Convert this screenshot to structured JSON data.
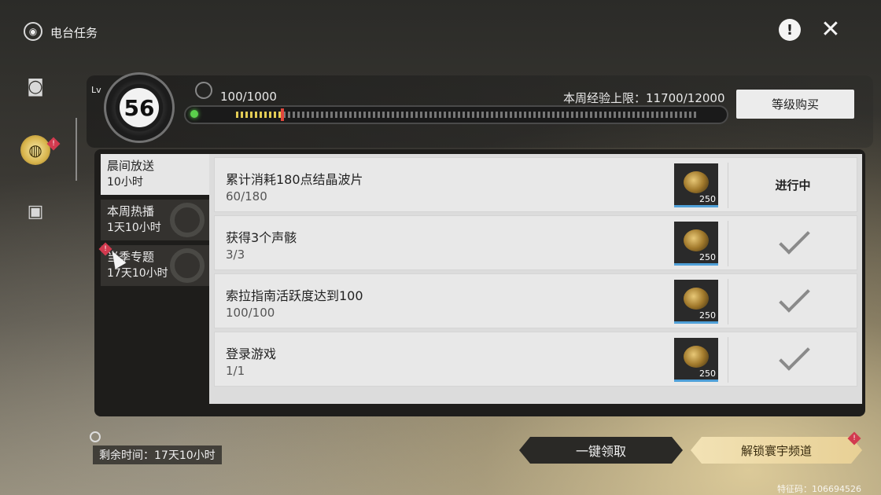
{
  "header": {
    "title": "电台任务",
    "app_icon": "radio-icon",
    "help_icon": "exclamation-circle-icon",
    "close_icon": "close-star-icon"
  },
  "sidebar": {
    "items": [
      {
        "icon": "radio-icon",
        "active": false
      },
      {
        "icon": "pass-icon",
        "active": true,
        "badge": "!"
      },
      {
        "icon": "box-icon",
        "active": false
      }
    ]
  },
  "level": {
    "lv_label": "Lv",
    "value": "56",
    "exp_text": "100/1000",
    "exp_fraction": 0.1,
    "weekly_limit": "本周经验上限：11700/12000",
    "buy_label": "等级购买"
  },
  "tabs": [
    {
      "title": "晨间放送",
      "sub": "10小时",
      "active": true
    },
    {
      "title": "本周热播",
      "sub": "1天10小时",
      "active": false
    },
    {
      "title": "当季专题",
      "sub": "17天10小时",
      "active": false,
      "badge": "!"
    }
  ],
  "tasks": [
    {
      "title": "累计消耗180点结晶波片",
      "progress": "60/180",
      "reward_qty": "250",
      "status": "进行中",
      "done": false
    },
    {
      "title": "获得3个声骸",
      "progress": "3/3",
      "reward_qty": "250",
      "status": "",
      "done": true
    },
    {
      "title": "索拉指南活跃度达到100",
      "progress": "100/100",
      "reward_qty": "250",
      "status": "",
      "done": true
    },
    {
      "title": "登录游戏",
      "progress": "1/1",
      "reward_qty": "250",
      "status": "",
      "done": true
    }
  ],
  "footer": {
    "remaining": "剩余时间：17天10小时",
    "claim_all": "一键领取",
    "unlock": "解锁寰宇频道",
    "unlock_badge": "!",
    "feature_code": "特征码：106694526"
  },
  "colors": {
    "accent_gold": "#e8d095",
    "badge_red": "#d23a4f",
    "progress_green": "#5bd04c",
    "reward_border": "#4fa0d8"
  }
}
